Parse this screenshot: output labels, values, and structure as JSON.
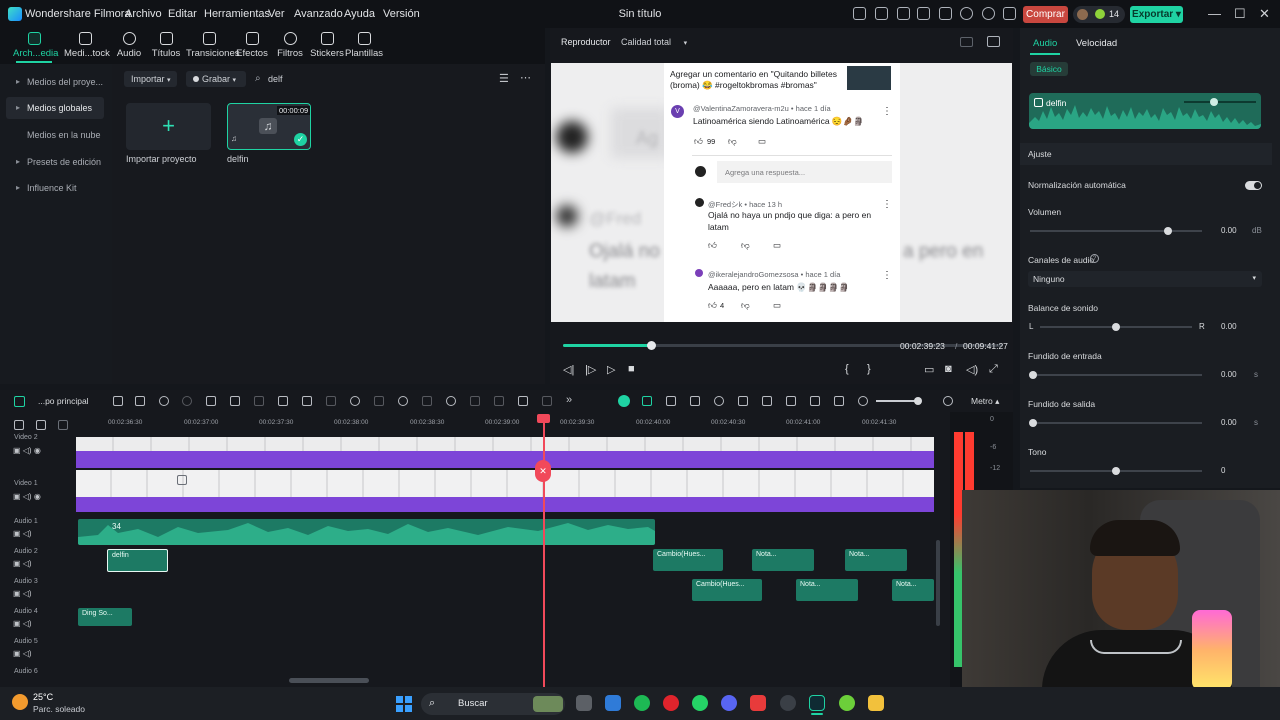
{
  "app": {
    "name": "Wondershare Filmora",
    "title": "Sin título"
  },
  "menu": [
    "Archivo",
    "Editar",
    "Herramientas",
    "Ver",
    "Avanzado",
    "Ayuda",
    "Versión"
  ],
  "header": {
    "buy_label": "Comprar",
    "export_label": "Exportar",
    "credits": "14"
  },
  "toolbar": [
    {
      "label": "Arch...edia",
      "icon": "folder-icon",
      "active": true
    },
    {
      "label": "Medi...tock",
      "icon": "stock-media-icon"
    },
    {
      "label": "Audio",
      "icon": "music-note-icon"
    },
    {
      "label": "Títulos",
      "icon": "text-icon"
    },
    {
      "label": "Transiciones",
      "icon": "transition-icon"
    },
    {
      "label": "Efectos",
      "icon": "effects-icon"
    },
    {
      "label": "Filtros",
      "icon": "filter-icon"
    },
    {
      "label": "Stickers",
      "icon": "sticker-icon"
    },
    {
      "label": "Plantillas",
      "icon": "template-icon"
    }
  ],
  "sidebar": [
    {
      "label": "Medios del proye...",
      "chevron": "▸"
    },
    {
      "label": "Medios globales",
      "chevron": "▸",
      "selected": true
    },
    {
      "label": "Medios en la nube",
      "chevron": ""
    },
    {
      "label": "Presets de edición",
      "chevron": "▸"
    },
    {
      "label": "Influence Kit",
      "chevron": "▸"
    }
  ],
  "media": {
    "import_label": "Importar",
    "record_label": "Grabar",
    "search_value": "delf",
    "import_card_label": "Importar proyecto",
    "clip": {
      "name": "delfin",
      "duration": "00:00:09"
    }
  },
  "player": {
    "tab": "Reproductor",
    "quality": "Calidad total",
    "current_time": "00:02:39:23",
    "separator": "/",
    "total_time": "00:09:41:27",
    "progress": 0.2
  },
  "video_overlay": {
    "header_text_1": "Agregar un comentario en \"Quitando billetes",
    "header_text_2": "(broma) 😂 #rogeltokbromas #bromas\"",
    "c1_user": "@ValentinaZamoravera-m2u • hace 1 día",
    "c1_text": "Latinoamérica siendo Latinoamérica 😔🤌🏾🗿",
    "c1_likes": "99",
    "reply_placeholder": "Agrega una respuesta...",
    "c2_user": "@Fredシk • hace 13 h",
    "c2_text_1": "Ojalá no haya un pndjo que diga: a pero en",
    "c2_text_2": "latam",
    "c3_user": "@ikeralejandroGomezsosa • hace 1 día",
    "c3_text": "Aaaaaa, pero en latam 💀🗿🗿🗿🗿",
    "c3_likes": "4",
    "blur_1": "Ag",
    "blur_2": "@Fred",
    "blur_3": "Ojalá no",
    "blur_4": "latam",
    "blur_5": "a pero en"
  },
  "properties": {
    "tabs": [
      "Audio",
      "Velocidad"
    ],
    "subtab": "Básico",
    "clip_name": "delfin",
    "ajuste": "Ajuste",
    "normalization": "Normalización automática",
    "volume": {
      "label": "Volumen",
      "value": "0.00",
      "unit": "dB",
      "level": 0.8
    },
    "channels": {
      "label": "Canales de audio",
      "value": "Ninguno"
    },
    "balance": {
      "label": "Balance de sonido",
      "left": "L",
      "right": "R",
      "value": "0.00",
      "level": 0.5
    },
    "fade_in": {
      "label": "Fundido de entrada",
      "value": "0.00",
      "unit": "s",
      "level": 0
    },
    "fade_out": {
      "label": "Fundido  de salida",
      "value": "0.00",
      "unit": "s",
      "level": 0
    },
    "pitch": {
      "label": "Tono",
      "value": "0",
      "level": 0.5
    }
  },
  "timeline": {
    "sequence_label": "...po principal",
    "metro_label": "Metro",
    "ruler_ticks": [
      "00:02:36:30",
      "00:02:37:00",
      "00:02:37:30",
      "00:02:38:00",
      "00:02:38:30",
      "00:02:39:00",
      "00:02:39:30",
      "00:02:40:00",
      "00:02:40:30",
      "00:02:41:00",
      "00:02:41:30"
    ],
    "tracks": [
      "Video 2",
      "Video 1",
      "Audio 1",
      "Audio 2",
      "Audio 3",
      "Audio 4",
      "Audio 5",
      "Audio 6"
    ],
    "audio1_clip_label": "34",
    "audio2_clips": [
      "delfin",
      "Cambio(Hues...",
      "Nota...",
      "Nota..."
    ],
    "audio3_clips": [
      "Cambio(Hues...",
      "Nota...",
      "Nota..."
    ],
    "audio4_clip": "Ding So...",
    "vu_labels": [
      "0",
      "-6",
      "-12"
    ]
  },
  "taskbar": {
    "temperature": "25°C",
    "weather": "Parc. soleado",
    "search": "Buscar"
  },
  "colors": {
    "accent": "#1fd3a3",
    "video_track": "#7d45d8",
    "audio_clip": "#1d7a64",
    "playhead": "#f1495a"
  }
}
